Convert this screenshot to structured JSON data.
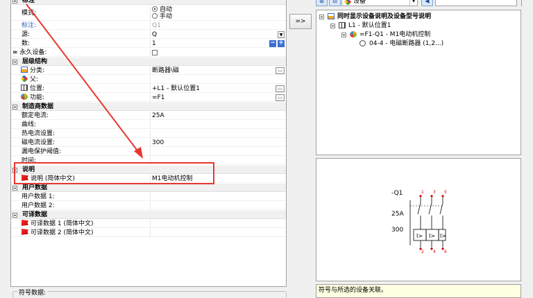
{
  "props": {
    "section_biaozhu": "标注",
    "mode_label": "模式:",
    "mode_auto": "自动",
    "mode_manual": "手动",
    "tag_label": "标注:",
    "tag_value": "Q1",
    "source_label": "源:",
    "source_value": "Q",
    "count_label": "数:",
    "count_value": "1",
    "permanent_label": "永久设备:",
    "section_hierarchy": "层级结构",
    "category_label": "分类:",
    "category_value": "断路器\\磁",
    "parent_label": "父:",
    "position_label": "位置:",
    "position_value": "+L1 - 默认位置1",
    "function_label": "功能:",
    "function_value": "=F1",
    "section_manufacturer": "制造商数据",
    "rated_current_label": "额定电流:",
    "rated_current_value": "25A",
    "curve_label": "曲线:",
    "thermal_label": "热电流设置:",
    "magnetic_label": "磁电流设置:",
    "magnetic_value": "300",
    "leakage_label": "漏电保护阈值:",
    "time_label": "时间:",
    "section_description": "说明",
    "description_label": "说明 (简体中文)",
    "description_value": "M1电动机控制",
    "section_userdata": "用户数据",
    "userdata1_label": "用户数据 1:",
    "userdata2_label": "用户数据 2:",
    "section_translatable": "可译数据",
    "translatable1_label": "可译数据 1 (简体中文)",
    "translatable2_label": "可译数据 2 (简体中文)"
  },
  "symbol_group_label": "符号数据:",
  "assign_button_label": "=>",
  "right": {
    "device_combo": "设备",
    "tree": {
      "root": "同时显示设备说明及设备型号说明",
      "location": "L1 - 默认位置1",
      "device": "=F1-Q1 - M1电动机控制",
      "part": "04-4 - 电磁断路器 (1,2...)"
    },
    "hint": "符号与所选的设备关联。"
  },
  "schematic": {
    "tag": "-Q1",
    "rating": "25A",
    "setting": "300",
    "terminals_top": [
      "1",
      "3",
      "5"
    ],
    "terminals_bottom": [
      "2",
      "4",
      "6"
    ]
  },
  "colors": {
    "highlight": "#e8362e",
    "arrow": "#e8362e",
    "link_blue": "#2a5db0"
  }
}
